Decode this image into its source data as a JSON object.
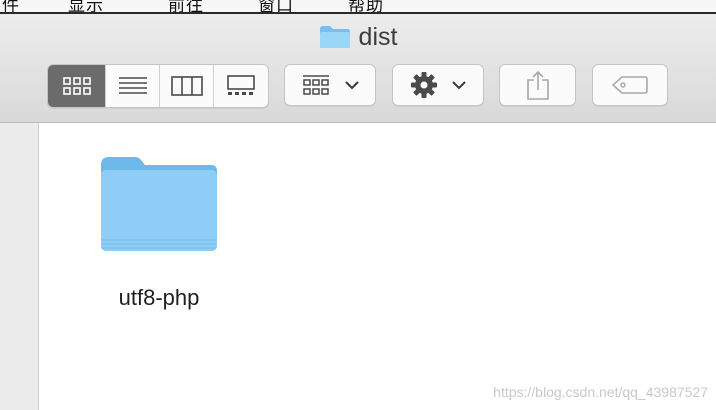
{
  "menubar": {
    "items": [
      "件",
      "显示",
      "前往",
      "窗口",
      "帮助"
    ]
  },
  "window": {
    "title": "dist",
    "title_icon": "folder-icon"
  },
  "toolbar": {
    "view_buttons": [
      {
        "name": "icon-view",
        "icon": "icon-grid-icon",
        "active": true
      },
      {
        "name": "list-view",
        "icon": "list-icon",
        "active": false
      },
      {
        "name": "column-view",
        "icon": "columns-icon",
        "active": false
      },
      {
        "name": "gallery-view",
        "icon": "gallery-icon",
        "active": false
      }
    ],
    "group_button": {
      "icon": "group-by-icon"
    },
    "action_button": {
      "icon": "gear-icon"
    },
    "share_button": {
      "icon": "share-icon"
    },
    "tag_button": {
      "icon": "tag-icon"
    }
  },
  "files": [
    {
      "name": "utf8-php",
      "kind": "folder"
    }
  ],
  "watermark": "https://blog.csdn.net/qq_43987527",
  "colors": {
    "folder_blue": "#8ecdf5",
    "active_segment": "#6b6b6b"
  }
}
